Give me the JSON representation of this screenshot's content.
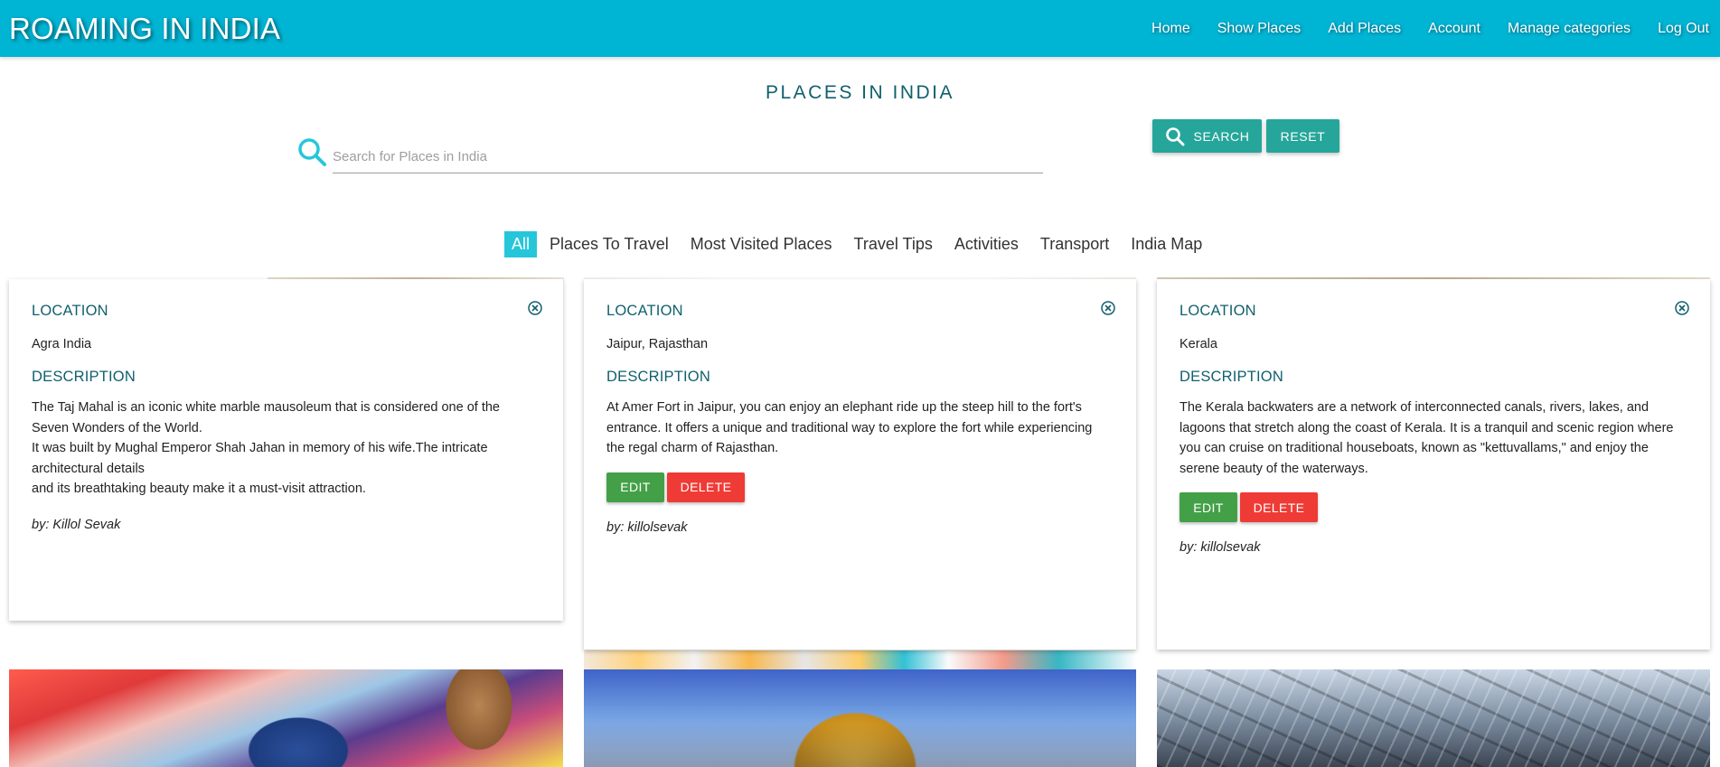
{
  "header": {
    "brand": "ROAMING IN INDIA",
    "nav": [
      "Home",
      "Show Places",
      "Add Places",
      "Account",
      "Manage categories",
      "Log Out"
    ]
  },
  "main": {
    "title": "PLACES IN INDIA",
    "search": {
      "placeholder": "Search for Places in India",
      "value": "",
      "search_label": "SEARCH",
      "reset_label": "RESET"
    },
    "categories": [
      "All",
      "Places To Travel",
      "Most Visited Places",
      "Travel Tips",
      "Activities",
      "Transport",
      "India Map"
    ],
    "active_category": "All",
    "cards": [
      {
        "location_label": "LOCATION",
        "location": "Agra India",
        "description_label": "DESCRIPTION",
        "description_lines": [
          "The Taj Mahal is an iconic white marble mausoleum that is considered one of the Seven Wonders of the World.",
          "It was built by Mughal Emperor Shah Jahan in memory of his wife.The intricate architectural details",
          "and its breathtaking beauty make it a must-visit attraction."
        ],
        "author": "by: Killol Sevak"
      },
      {
        "location_label": "LOCATION",
        "location": "Jaipur, Rajasthan",
        "description_label": "DESCRIPTION",
        "description_lines": [
          "At Amer Fort in Jaipur, you can enjoy an elephant ride up the steep hill to the fort's entrance. It offers a unique and traditional way to explore the fort while experiencing the regal charm of Rajasthan."
        ],
        "edit_label": "EDIT",
        "delete_label": "DELETE",
        "author": "by: killolsevak"
      },
      {
        "location_label": "LOCATION",
        "location": "Kerala",
        "description_label": "DESCRIPTION",
        "description_lines": [
          "The Kerala backwaters are a network of interconnected canals, rivers, lakes, and lagoons that stretch along the coast of Kerala. It is a tranquil and scenic region where you can cruise on traditional houseboats, known as \"kettuvallams,\" and enjoy the serene beauty of the waterways."
        ],
        "edit_label": "EDIT",
        "delete_label": "DELETE",
        "author": "by: killolsevak"
      }
    ]
  },
  "colors": {
    "navbar": "#00b4d4",
    "accent_teal": "#26a69a",
    "active_tab": "#26c6da",
    "label_text": "#11606e",
    "edit_green": "#43a047",
    "delete_red": "#ef3b35"
  },
  "icons": [
    "search-icon",
    "close-circle-icon"
  ]
}
